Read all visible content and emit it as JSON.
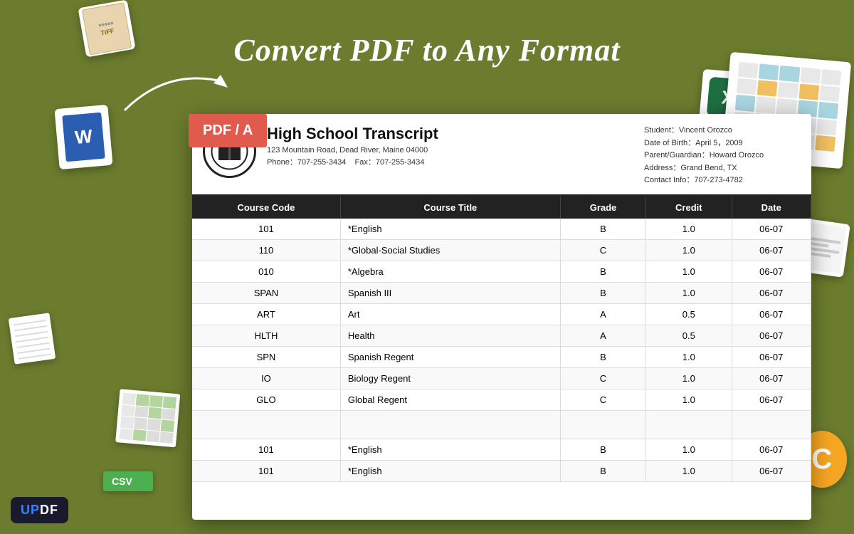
{
  "page": {
    "title": "Convert PDF to Any Format",
    "background_color": "#6b7c2e"
  },
  "pdf_badge": {
    "label": "PDF / A"
  },
  "updf": {
    "label": "UPDF"
  },
  "school": {
    "name": "High School Transcript",
    "address": "123 Mountain Road, Dead River, Maine 04000",
    "phone": "Phone：707-255-3434",
    "fax": "Fax：707-255-3434"
  },
  "student": {
    "name_label": "Student：Vincent Orozco",
    "dob_label": "Date of Birth：April 5，2009",
    "guardian_label": "Parent/Guardian：Howard Orozco",
    "address_label": "Address：Grand Bend, TX",
    "contact_label": "Contact Info：707-273-4782"
  },
  "table": {
    "headers": [
      "Course Code",
      "Course Title",
      "Grade",
      "Credit",
      "Date"
    ],
    "rows": [
      {
        "code": "101",
        "title": "*English",
        "grade": "B",
        "credit": "1.0",
        "date": "06-07"
      },
      {
        "code": "110",
        "title": "*Global-Social Studies",
        "grade": "C",
        "credit": "1.0",
        "date": "06-07"
      },
      {
        "code": "010",
        "title": "*Algebra",
        "grade": "B",
        "credit": "1.0",
        "date": "06-07"
      },
      {
        "code": "SPAN",
        "title": "Spanish III",
        "grade": "B",
        "credit": "1.0",
        "date": "06-07"
      },
      {
        "code": "ART",
        "title": "Art",
        "grade": "A",
        "credit": "0.5",
        "date": "06-07"
      },
      {
        "code": "HLTH",
        "title": "Health",
        "grade": "A",
        "credit": "0.5",
        "date": "06-07"
      },
      {
        "code": "SPN",
        "title": "Spanish Regent",
        "grade": "B",
        "credit": "1.0",
        "date": "06-07"
      },
      {
        "code": "IO",
        "title": "Biology Regent",
        "grade": "C",
        "credit": "1.0",
        "date": "06-07"
      },
      {
        "code": "GLO",
        "title": "Global Regent",
        "grade": "C",
        "credit": "1.0",
        "date": "06-07"
      },
      {
        "code": "",
        "title": "",
        "grade": "",
        "credit": "",
        "date": ""
      },
      {
        "code": "101",
        "title": "*English",
        "grade": "B",
        "credit": "1.0",
        "date": "06-07"
      },
      {
        "code": "101",
        "title": "*English",
        "grade": "B",
        "credit": "1.0",
        "date": "06-07"
      }
    ]
  }
}
